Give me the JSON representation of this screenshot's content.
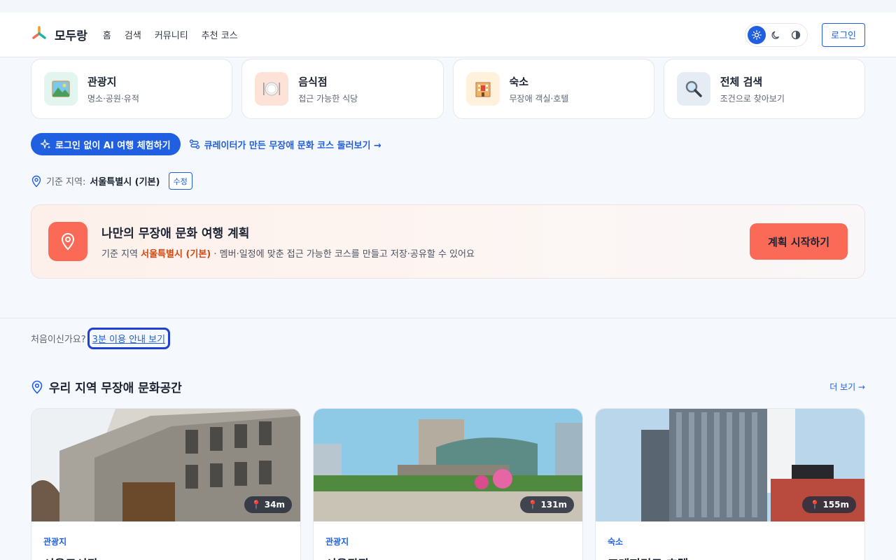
{
  "header": {
    "logo_text": "모두랑",
    "nav": [
      "홈",
      "검색",
      "커뮤니티",
      "추천 코스"
    ],
    "theme_options": [
      "sun-icon",
      "moon-icon",
      "contrast-icon"
    ],
    "login_label": "로그인"
  },
  "categories": [
    {
      "title": "관광지",
      "sub": "명소·공원·유적",
      "icon": "landscape-icon"
    },
    {
      "title": "음식점",
      "sub": "접근 가능한 식당",
      "icon": "plate-icon"
    },
    {
      "title": "숙소",
      "sub": "무장애 객실·호텔",
      "icon": "hotel-icon"
    },
    {
      "title": "전체 검색",
      "sub": "조건으로 찾아보기",
      "icon": "magnifier-icon"
    }
  ],
  "cta": {
    "ai_label": "로그인 없이 AI 여행 체험하기",
    "course_label": "큐레이터가 만든 무장애 문화 코스 둘러보기 →"
  },
  "region": {
    "label": "기준 지역:",
    "value": "서울특별시 (기본)",
    "edit_label": "수정"
  },
  "plan": {
    "title": "나만의 무장애 문화 여행 계획",
    "desc_prefix": "기준 지역",
    "desc_region": "서울특별시 (기본)",
    "desc_suffix": "· 멤버·일정에 맞춘 접근 가능한 코스를 만들고 저장·공유할 수 있어요",
    "button": "계획 시작하기"
  },
  "guide": {
    "text": "처음이신가요?",
    "link": "3분 이용 안내 보기"
  },
  "section": {
    "title": "우리 지역 무장애 문화공간",
    "more": "더 보기 →"
  },
  "places": [
    {
      "category": "관광지",
      "name": "서울도서관",
      "distance": "34m"
    },
    {
      "category": "관광지",
      "name": "서울광장",
      "distance": "131m"
    },
    {
      "category": "숙소",
      "name": "프레지던트 호텔",
      "distance": "155m"
    }
  ],
  "colors": {
    "primary": "#1f5fe0",
    "accent": "#fb6a57",
    "highlight": "#d04a12"
  }
}
